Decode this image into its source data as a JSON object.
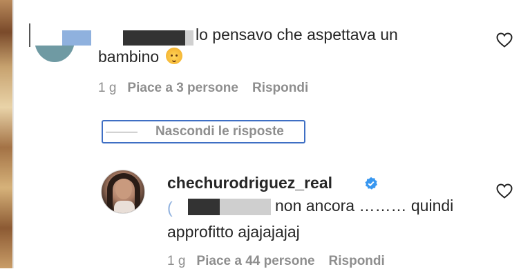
{
  "comment1": {
    "text_line1": "lo pensavo che aspettava un",
    "text_line2": "bambino",
    "emoji": "baby-emoji",
    "time": "1 g",
    "likes": "Piace a 3 persone",
    "reply": "Rispondi"
  },
  "hide_replies": {
    "label": "Nascondi le risposte"
  },
  "comment2": {
    "username": "chechurodriguez_real",
    "mention_prefix": "(",
    "text_line1": "non ancora ……… quindi",
    "text_line2": "approfitto ajajajajaj",
    "time": "1 g",
    "likes": "Piace a 44 persone",
    "reply": "Rispondi"
  },
  "icons": {
    "like": "heart-icon",
    "verified": "verified-badge-icon"
  },
  "colors": {
    "text": "#262626",
    "meta": "#8e8e8e",
    "verified": "#3897f0",
    "focus_outline": "#3f6fc4"
  }
}
